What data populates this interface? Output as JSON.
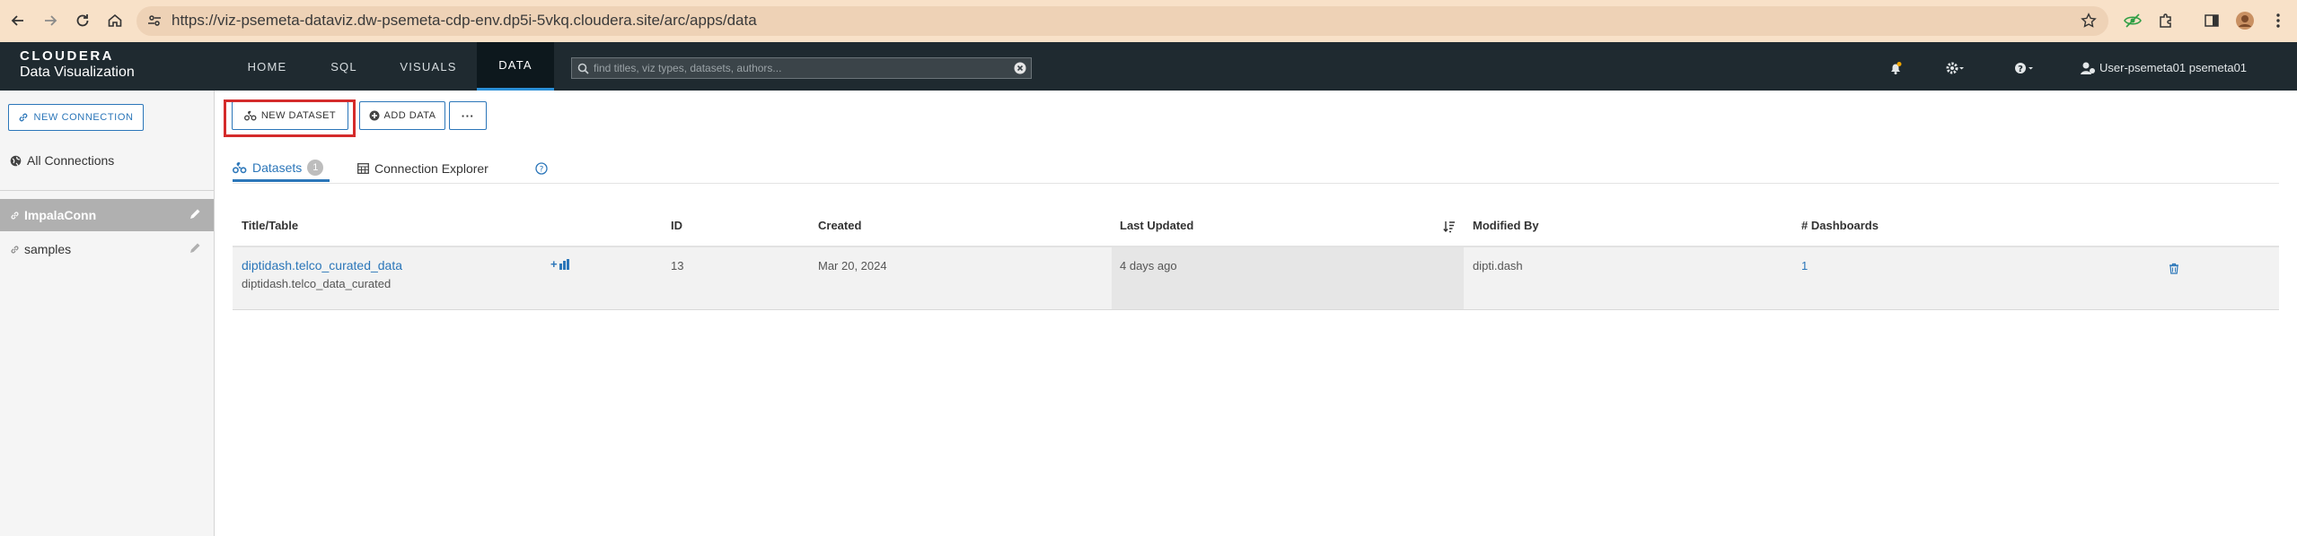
{
  "browser": {
    "url": "https://viz-psemeta-dataviz.dw-psemeta-cdp-env.dp5i-5vkq.cloudera.site/arc/apps/data"
  },
  "app": {
    "logo_top": "CLOUDERA",
    "logo_bottom": "Data Visualization",
    "nav": [
      "HOME",
      "SQL",
      "VISUALS",
      "DATA"
    ],
    "active_nav": "DATA",
    "search_placeholder": "find titles, viz types, datasets, authors...",
    "user": "User-psemeta01 psemeta01"
  },
  "sidebar": {
    "new_connection": "NEW CONNECTION",
    "all_connections": "All Connections",
    "connections": [
      "ImpalaConn",
      "samples"
    ],
    "active_connection": "ImpalaConn"
  },
  "toolbar": {
    "new_dataset": "NEW DATASET",
    "add_data": "ADD DATA",
    "more": "···"
  },
  "tabs": {
    "datasets": "Datasets",
    "datasets_count": "1",
    "connection_explorer": "Connection Explorer"
  },
  "table": {
    "columns": [
      "Title/Table",
      "ID",
      "Created",
      "Last Updated",
      "Modified By",
      "# Dashboards"
    ],
    "rows": [
      {
        "title": "diptidash.telco_curated_data",
        "table": "diptidash.telco_data_curated",
        "new_dashboard": "+",
        "id": "13",
        "created": "Mar 20, 2024",
        "last_updated": "4 days ago",
        "modified_by": "dipti.dash",
        "dashboards": "1"
      }
    ]
  },
  "colors": {
    "accent": "#2b76b9",
    "header_bg": "#1f2a30",
    "highlight_border": "#d42b2b",
    "browser_bar": "#f8e1c8"
  },
  "icons": [
    "back-arrow-icon",
    "forward-arrow-icon",
    "reload-icon",
    "home-icon",
    "site-info-icon",
    "star-icon",
    "eye-extension-icon",
    "puzzle-icon",
    "side-panel-icon",
    "profile-icon",
    "kebab-icon",
    "search-icon",
    "clear-icon",
    "bell-icon",
    "gear-icon",
    "help-icon",
    "user-icon",
    "link-icon",
    "globe-icon",
    "pencil-icon",
    "dataset-icon",
    "plus-circle-icon",
    "table-icon",
    "question-icon",
    "sort-icon",
    "chart-icon",
    "trash-icon"
  ]
}
